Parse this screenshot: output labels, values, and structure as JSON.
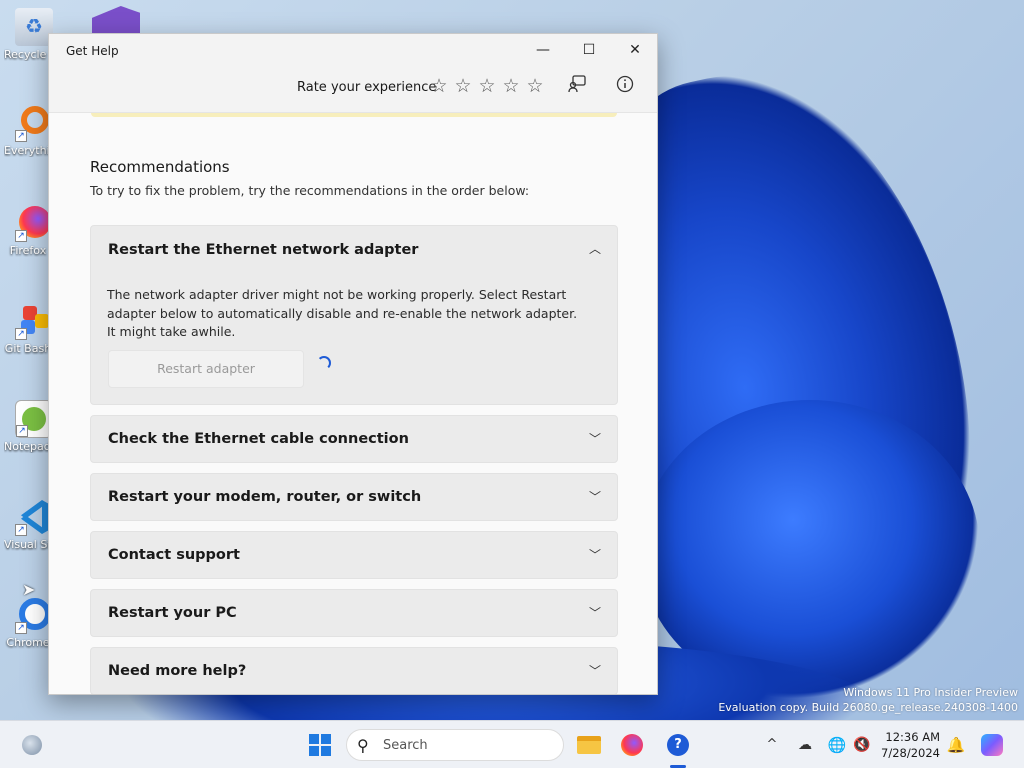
{
  "desktop": {
    "icons": [
      {
        "label": "Recycle Bin",
        "icon": "recycle-bin-icon"
      },
      {
        "label": "Everything",
        "icon": "everything-search-icon"
      },
      {
        "label": "Firefox",
        "icon": "firefox-icon"
      },
      {
        "label": "Git Bash",
        "icon": "git-bash-icon"
      },
      {
        "label": "Notepad++",
        "icon": "notepad-plus-plus-icon"
      },
      {
        "label": "Visual Studio Code",
        "icon": "vscode-icon"
      },
      {
        "label": "Chrome",
        "icon": "chrome-icon"
      }
    ],
    "watermark": {
      "line1": "Windows 11 Pro Insider Preview",
      "line2": "Evaluation copy. Build 26080.ge_release.240308-1400"
    }
  },
  "window": {
    "title": "Get Help",
    "controls": {
      "minimize": "—",
      "maximize": "☐",
      "close": "✕"
    },
    "toolbar": {
      "rate_label": "Rate your experience",
      "stars": [
        "☆",
        "☆",
        "☆",
        "☆",
        "☆"
      ],
      "feedback_icon": "feedback-icon",
      "info_icon": "info-icon"
    },
    "recommendations": {
      "title": "Recommendations",
      "subtitle": "To try to fix the problem, try the recommendations in the order below:",
      "cards": [
        {
          "title": "Restart the Ethernet network adapter",
          "expanded": true,
          "body": "The network adapter driver might not be working properly. Select Restart adapter below to automatically disable and re-enable the network adapter. It might take awhile.",
          "button": "Restart adapter"
        },
        {
          "title": "Check the Ethernet cable connection",
          "expanded": false
        },
        {
          "title": "Restart your modem, router, or switch",
          "expanded": false
        },
        {
          "title": "Contact support",
          "expanded": false
        },
        {
          "title": "Restart your PC",
          "expanded": false
        },
        {
          "title": "Need more help?",
          "expanded": false
        }
      ]
    }
  },
  "taskbar": {
    "search_placeholder": "Search",
    "apps": [
      "widgets-icon",
      "start-icon",
      "file-explorer-icon",
      "firefox-icon",
      "get-help-icon"
    ],
    "tray": {
      "chevron": "^",
      "time": "12:36 AM",
      "date": "7/28/2024"
    }
  }
}
